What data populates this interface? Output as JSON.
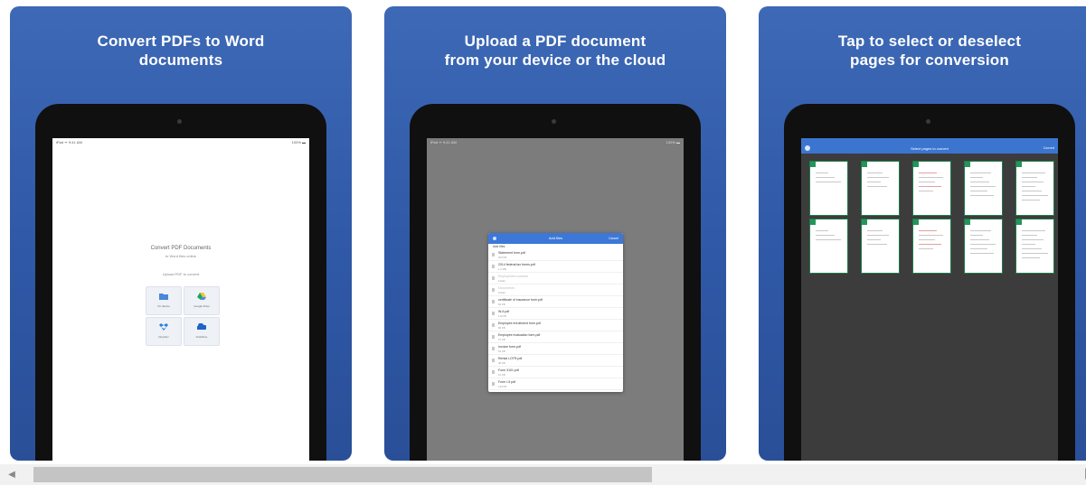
{
  "screenshots": [
    {
      "caption": "Convert PDFs to Word\ndocuments"
    },
    {
      "caption": "Upload a PDF document\nfrom your device or the cloud"
    },
    {
      "caption": "Tap to select or deselect\npages for conversion"
    }
  ],
  "screen1": {
    "status_left": "iPad ᯤ 9:41 AM",
    "status_right": "100% ▬",
    "heading": "Convert PDF Documents",
    "subheading": "to Word files online",
    "prompt": "Upload PDF to convert",
    "sources": [
      "On device",
      "Google Drive",
      "Dropbox",
      "OneDrive"
    ]
  },
  "screen2": {
    "dialog_title": "Add files",
    "dialog_action": "Cancel",
    "section_label": "Add files",
    "files": [
      {
        "name": "Statement form.pdf",
        "meta": "203 KB"
      },
      {
        "name": "2014 federal tax forms.pdf",
        "meta": "1.2 MB"
      },
      {
        "name": "Employment contract",
        "meta": "Folder"
      },
      {
        "name": "Documents",
        "meta": "Folder"
      },
      {
        "name": "certificate of insurance form.pdf",
        "meta": "84 KB"
      },
      {
        "name": "W-9.pdf",
        "meta": "110 KB"
      },
      {
        "name": "Employee enrollment form.pdf",
        "meta": "96 KB"
      },
      {
        "name": "Employee evaluation form.pdf",
        "meta": "72 KB"
      },
      {
        "name": "Invoice form.pdf",
        "meta": "54 KB"
      },
      {
        "name": "Rental LOTR.pdf",
        "meta": "48 KB"
      },
      {
        "name": "Form 3101.pdf",
        "meta": "61 KB"
      },
      {
        "name": "Form I-9.pdf",
        "meta": "140 KB"
      }
    ]
  },
  "screen3": {
    "title": "Select pages to convert",
    "action": "Convert"
  },
  "colors": {
    "card_blue": "#3461ad",
    "check_green": "#23965a",
    "header_blue": "#3b75d0"
  }
}
